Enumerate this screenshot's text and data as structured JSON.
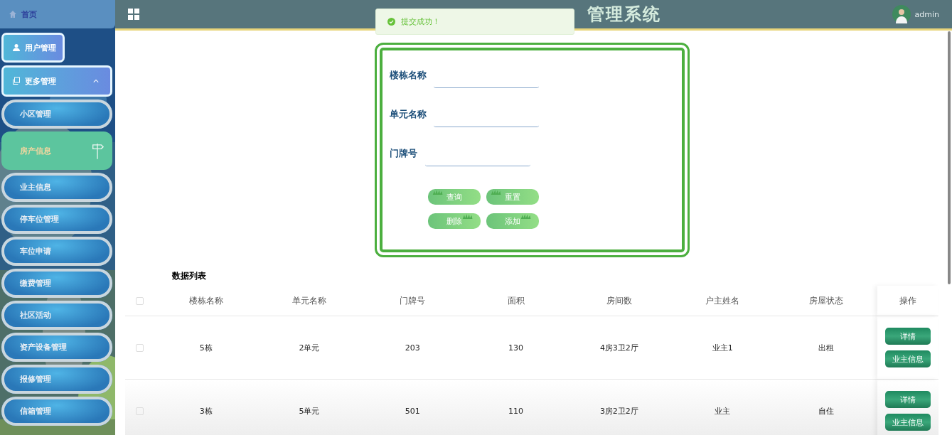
{
  "header": {
    "title": "管理系统",
    "user": "admin"
  },
  "toast": {
    "message": "提交成功！"
  },
  "sidebar": {
    "items": [
      {
        "label": "首页",
        "kind": "home"
      },
      {
        "label": "用户管理",
        "kind": "user"
      },
      {
        "label": "更多管理",
        "kind": "group",
        "expanded": true,
        "children": [
          {
            "label": "小区管理",
            "selected": false
          },
          {
            "label": "房产信息",
            "selected": true
          },
          {
            "label": "业主信息",
            "selected": false
          },
          {
            "label": "停车位管理",
            "selected": false
          },
          {
            "label": "车位申请",
            "selected": false
          },
          {
            "label": "缴费管理",
            "selected": false
          },
          {
            "label": "社区活动",
            "selected": false
          },
          {
            "label": "资产设备管理",
            "selected": false
          },
          {
            "label": "报修管理",
            "selected": false
          },
          {
            "label": "信箱管理",
            "selected": false
          }
        ]
      }
    ]
  },
  "search_form": {
    "fields": [
      {
        "label": "楼栋名称"
      },
      {
        "label": "单元名称"
      },
      {
        "label": "门牌号"
      }
    ],
    "buttons": [
      "查询",
      "重置",
      "删除",
      "添加"
    ]
  },
  "table": {
    "title": "数据列表",
    "header_checked": false,
    "columns": [
      "楼栋名称",
      "单元名称",
      "门牌号",
      "面积",
      "房间数",
      "户主姓名",
      "房屋状态",
      "操作"
    ],
    "rows": [
      {
        "checked": false,
        "cells": [
          "5栋",
          "2单元",
          "203",
          "130",
          "4房3卫2厅",
          "业主1",
          "出租"
        ],
        "actions": [
          "详情",
          "业主信息"
        ]
      },
      {
        "checked": false,
        "cells": [
          "3栋",
          "5单元",
          "501",
          "110",
          "3房2卫2厅",
          "业主",
          "自住"
        ],
        "actions": [
          "详情",
          "业主信息"
        ]
      }
    ]
  }
}
